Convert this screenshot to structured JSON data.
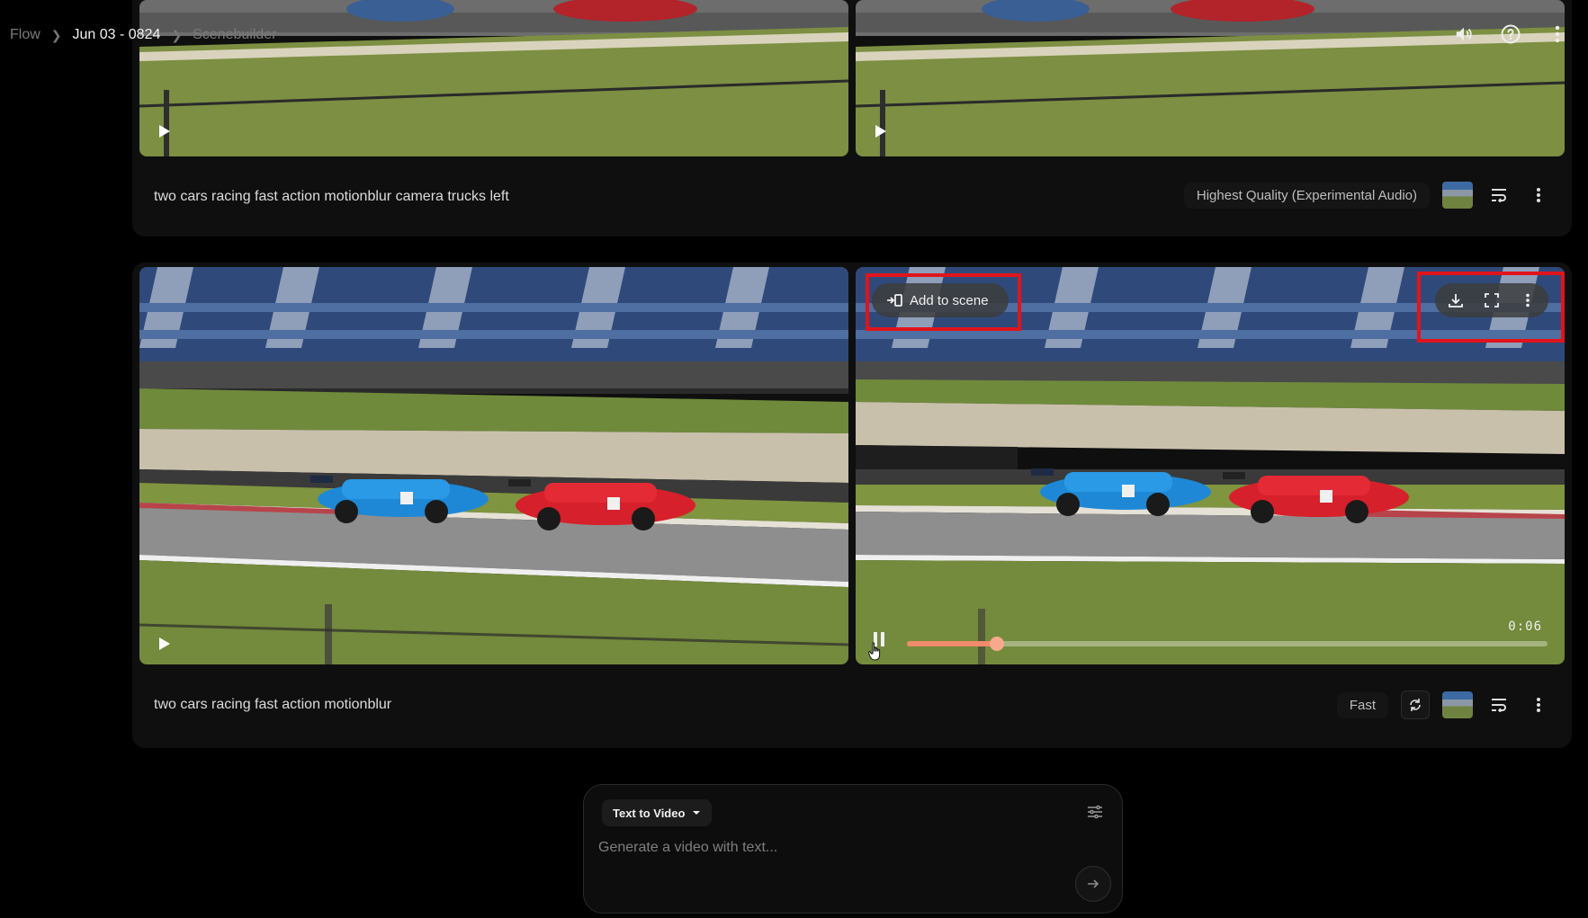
{
  "breadcrumb": {
    "root": "Flow",
    "project": "Jun 03 - 0824",
    "page": "Scenebuilder"
  },
  "header_actions": [
    "volume-icon",
    "help-icon",
    "more-vert-icon"
  ],
  "clips": [
    {
      "prompt": "two cars racing fast action motionblur camera trucks left",
      "quality": "Highest Quality (Experimental Audio)"
    },
    {
      "prompt": "two cars racing fast action motionblur",
      "quality": "Fast",
      "hovered_video": {
        "add_to_scene_label": "Add to scene",
        "timecode": "0:06",
        "progress_fraction": 0.14
      }
    }
  ],
  "composer": {
    "mode_label": "Text to Video",
    "placeholder": "Generate a video with text..."
  },
  "colors": {
    "highlight": "#e1141c",
    "progress": "#f28b6b",
    "background": "#000000"
  }
}
